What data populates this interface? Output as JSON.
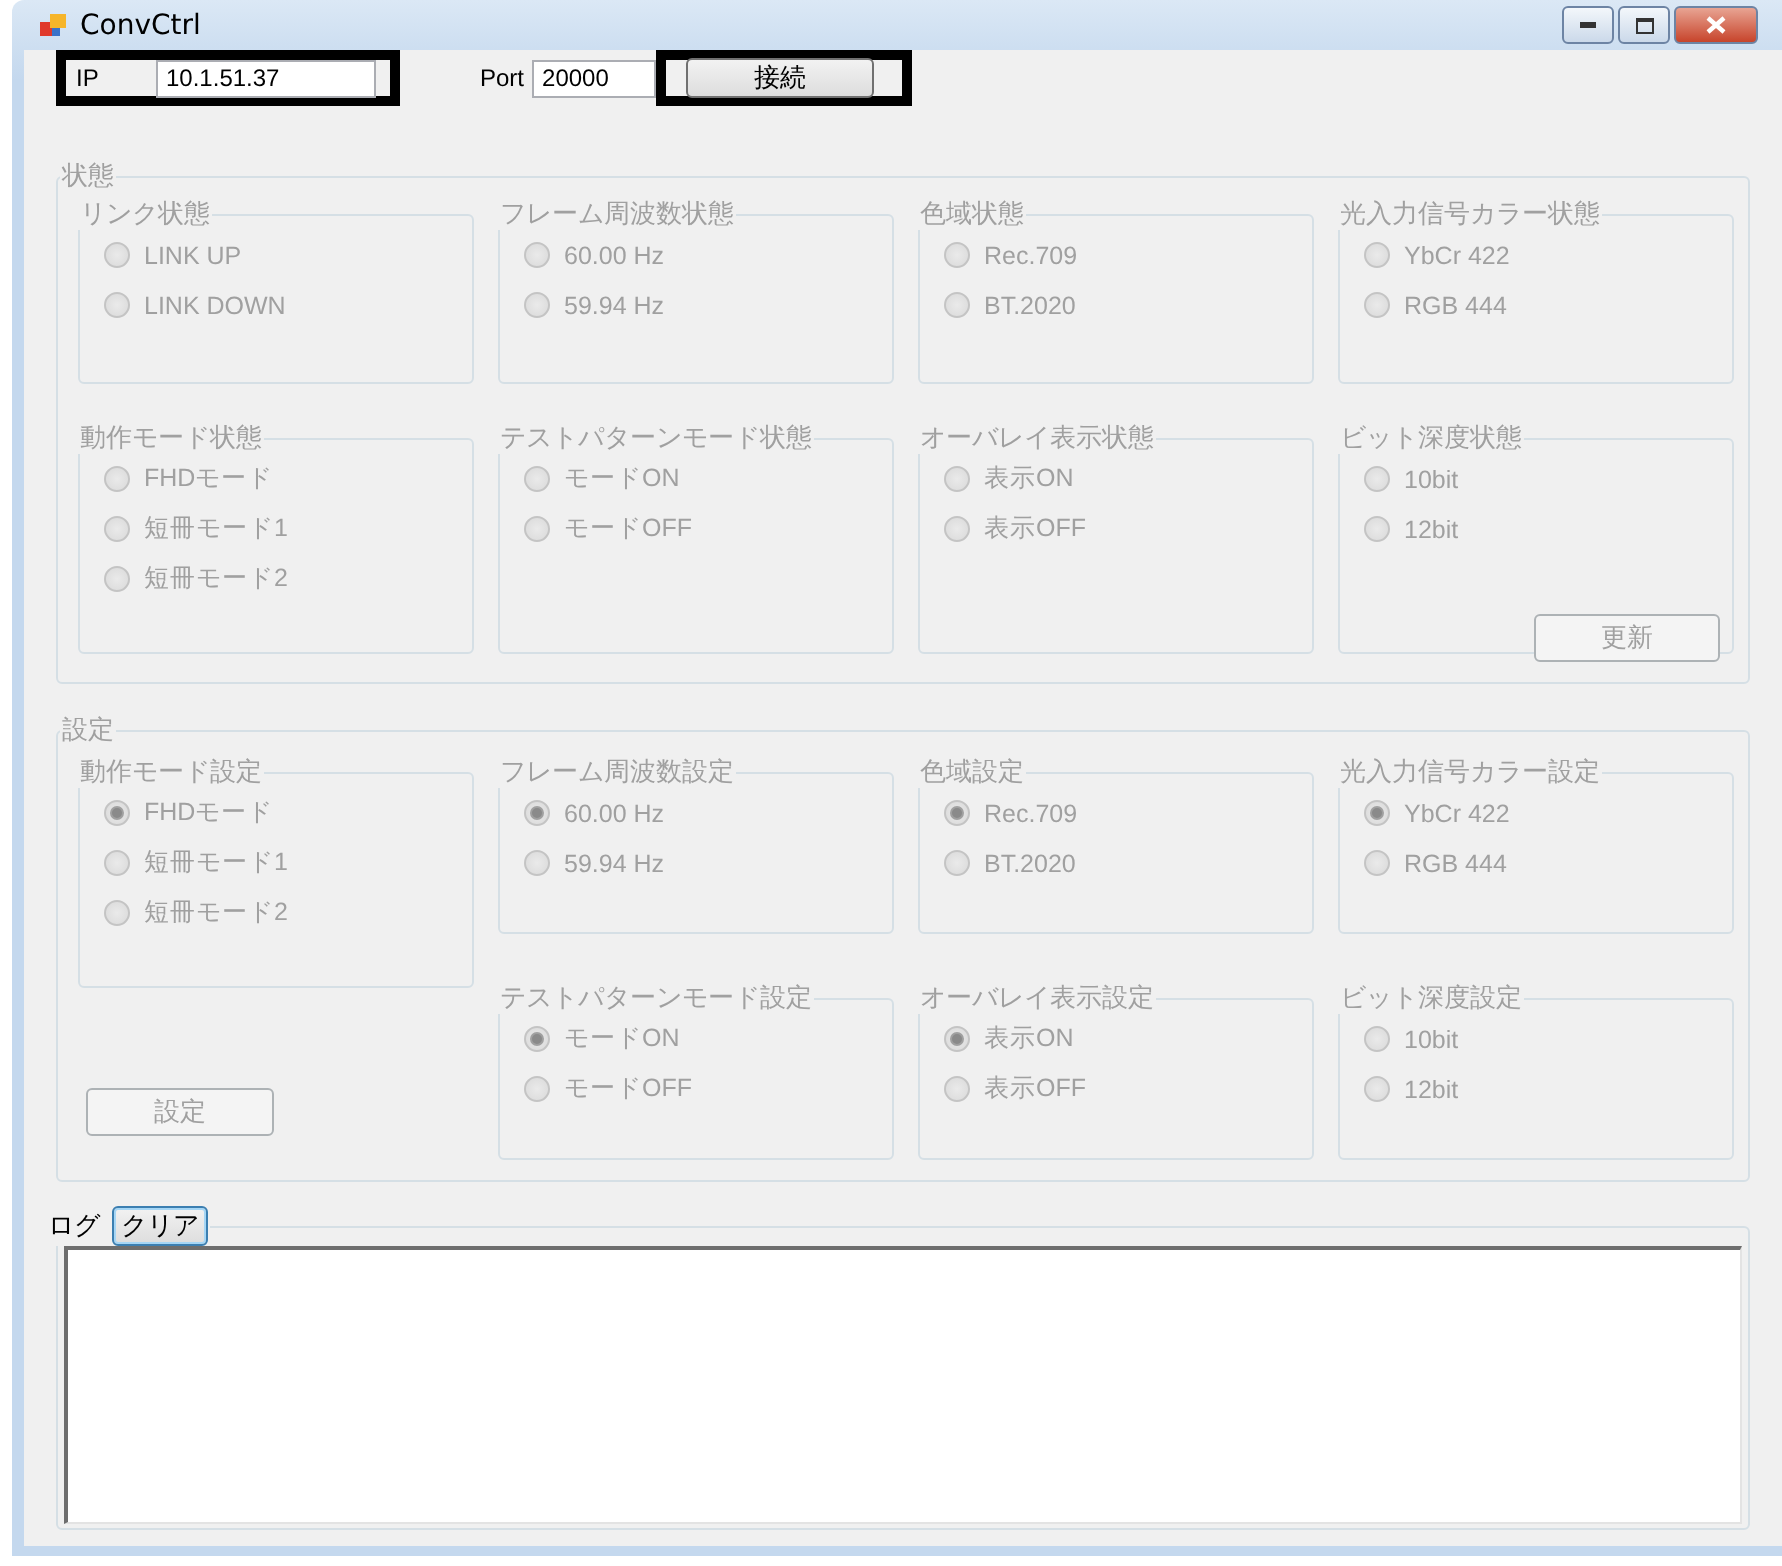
{
  "window": {
    "title": "ConvCtrl"
  },
  "connection": {
    "ip_label": "IP",
    "ip_value": "10.1.51.37",
    "port_label": "Port",
    "port_value": "20000",
    "connect_button": "接続"
  },
  "status": {
    "title": "状態",
    "disabled": true,
    "groups": [
      {
        "title": "リンク状態",
        "options": [
          {
            "label": "LINK UP",
            "selected": false
          },
          {
            "label": "LINK DOWN",
            "selected": false
          }
        ]
      },
      {
        "title": "フレーム周波数状態",
        "options": [
          {
            "label": "60.00 Hz",
            "selected": false
          },
          {
            "label": "59.94 Hz",
            "selected": false
          }
        ]
      },
      {
        "title": "色域状態",
        "options": [
          {
            "label": "Rec.709",
            "selected": false
          },
          {
            "label": "BT.2020",
            "selected": false
          }
        ]
      },
      {
        "title": "光入力信号カラー状態",
        "options": [
          {
            "label": "YbCr 422",
            "selected": false
          },
          {
            "label": "RGB 444",
            "selected": false
          }
        ]
      },
      {
        "title": "動作モード状態",
        "options": [
          {
            "label": "FHDモード",
            "selected": false
          },
          {
            "label": "短冊モード1",
            "selected": false
          },
          {
            "label": "短冊モード2",
            "selected": false
          }
        ]
      },
      {
        "title": "テストパターンモード状態",
        "options": [
          {
            "label": "モードON",
            "selected": false
          },
          {
            "label": "モードOFF",
            "selected": false
          }
        ]
      },
      {
        "title": "オーバレイ表示状態",
        "options": [
          {
            "label": "表示ON",
            "selected": false
          },
          {
            "label": "表示OFF",
            "selected": false
          }
        ]
      },
      {
        "title": "ビット深度状態",
        "options": [
          {
            "label": "10bit",
            "selected": false
          },
          {
            "label": "12bit",
            "selected": false
          }
        ]
      }
    ],
    "button": "更新"
  },
  "settings": {
    "title": "設定",
    "disabled": true,
    "groups": [
      {
        "title": "動作モード設定",
        "options": [
          {
            "label": "FHDモード",
            "selected": true
          },
          {
            "label": "短冊モード1",
            "selected": false
          },
          {
            "label": "短冊モード2",
            "selected": false
          }
        ]
      },
      {
        "title": "フレーム周波数設定",
        "options": [
          {
            "label": "60.00 Hz",
            "selected": true
          },
          {
            "label": "59.94 Hz",
            "selected": false
          }
        ]
      },
      {
        "title": "色域設定",
        "options": [
          {
            "label": "Rec.709",
            "selected": true
          },
          {
            "label": "BT.2020",
            "selected": false
          }
        ]
      },
      {
        "title": "光入力信号カラー設定",
        "options": [
          {
            "label": "YbCr 422",
            "selected": true
          },
          {
            "label": "RGB 444",
            "selected": false
          }
        ]
      },
      {
        "title": "テストパターンモード設定",
        "options": [
          {
            "label": "モードON",
            "selected": true
          },
          {
            "label": "モードOFF",
            "selected": false
          }
        ]
      },
      {
        "title": "オーバレイ表示設定",
        "options": [
          {
            "label": "表示ON",
            "selected": true
          },
          {
            "label": "表示OFF",
            "selected": false
          }
        ]
      },
      {
        "title": "ビット深度設定",
        "options": [
          {
            "label": "10bit",
            "selected": false
          },
          {
            "label": "12bit",
            "selected": false
          }
        ]
      }
    ],
    "button": "設定"
  },
  "log": {
    "label": "ログ",
    "clear_button": "クリア"
  }
}
